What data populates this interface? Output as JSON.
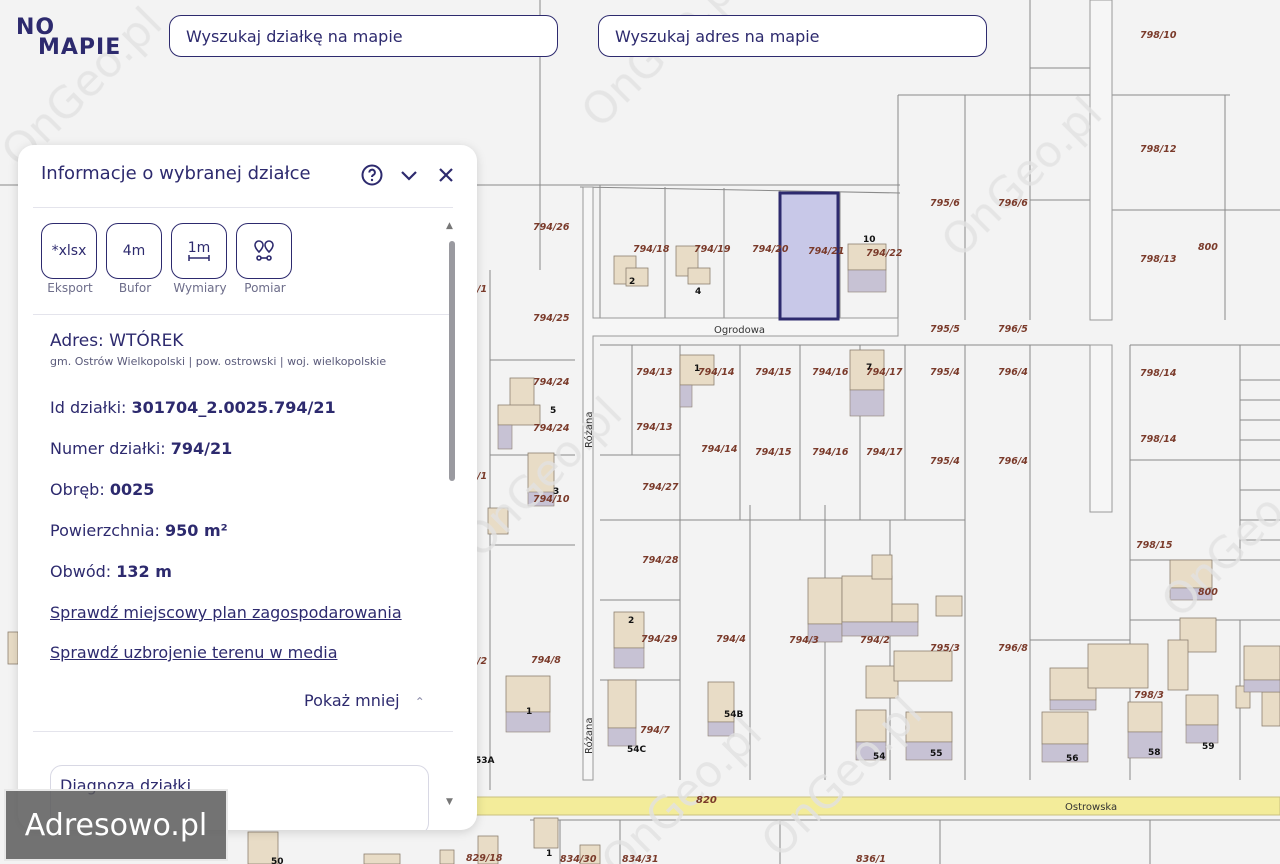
{
  "logo": {
    "line1": "NO",
    "line2": "MAPIE"
  },
  "search": {
    "plot_placeholder": "Wyszukaj działkę na mapie",
    "address_placeholder": "Wyszukaj adres na mapie"
  },
  "panel": {
    "title": "Informacje o wybranej działce",
    "tools": [
      {
        "icon": "*xlsx",
        "label": "Eksport"
      },
      {
        "icon": "4m",
        "label": "Bufor"
      },
      {
        "icon": "1m",
        "label": "Wymiary"
      },
      {
        "icon": "pin-pair-icon",
        "label": "Pomiar"
      }
    ],
    "address_title": "Adres: WTÓREK",
    "address_sub": "gm. Ostrów Wielkopolski | pow. ostrowski | woj. wielkopolskie",
    "fields": [
      {
        "label": "Id działki:",
        "value": "301704_2.0025.794/21"
      },
      {
        "label": "Numer działki:",
        "value": "794/21"
      },
      {
        "label": "Obręb:",
        "value": "0025"
      },
      {
        "label": "Powierzchnia:",
        "value": "950 m²"
      },
      {
        "label": "Obwód:",
        "value": "132 m"
      }
    ],
    "links": [
      "Sprawdź miejscowy plan zagospodarowania",
      "Sprawdź uzbrojenie terenu w media"
    ],
    "show_less": "Pokaż mniej",
    "diagnosis_title": "Diagnoza działki"
  },
  "map": {
    "selected_parcel": "794/21",
    "streets": [
      "Ogrodowa",
      "Różana",
      "Różana",
      "Ostrowska"
    ],
    "road_numbers": [
      "820"
    ],
    "parcel_labels": [
      "798/10",
      "798/12",
      "798/13",
      "800",
      "795/6",
      "796/6",
      "794/26",
      "794/18",
      "794/19",
      "794/20",
      "794/21",
      "794/22",
      "795/5",
      "796/5",
      "794/25",
      "794/24",
      "794/24",
      "794/13",
      "794/14",
      "794/15",
      "794/16",
      "794/17",
      "795/4",
      "796/4",
      "798/14",
      "798/14",
      "794/13",
      "794/14",
      "794/15",
      "794/16",
      "794/17",
      "795/4",
      "796/4",
      "794/10",
      "794/27",
      "798/15",
      "794/28",
      "800",
      "794/29",
      "794/4",
      "794/3",
      "794/2",
      "795/3",
      "796/8",
      "794/8",
      "798/3",
      "794/7",
      "829/18",
      "834/30",
      "834/31",
      "836/1",
      "/1",
      "/1",
      "/2"
    ],
    "house_numbers": [
      "10",
      "2",
      "4",
      "1",
      "5",
      "3",
      "7",
      "2",
      "1",
      "54B",
      "54C",
      "54",
      "55",
      "56",
      "58",
      "59",
      "53A",
      "1",
      "50"
    ],
    "map_watermark": "OnGeo.pl"
  },
  "footer_watermark": "Adresowo.pl",
  "colors": {
    "brand": "#2d2a6e",
    "selected_fill": "#c8c8e8",
    "road": "#f3ec9a",
    "building": "#e8dcc6"
  }
}
